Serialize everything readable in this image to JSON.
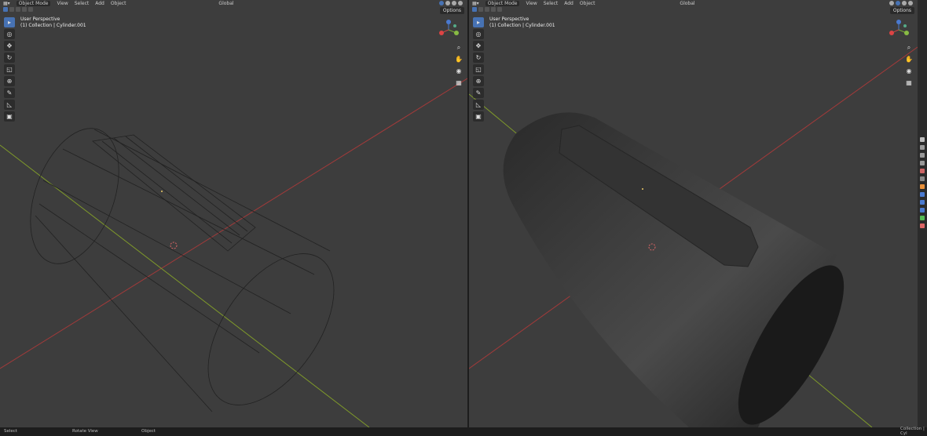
{
  "header": {
    "mode": "Object Mode",
    "menus": [
      "View",
      "Select",
      "Add",
      "Object"
    ],
    "orientation": "Global",
    "options": "Options"
  },
  "viewport_left": {
    "view_name": "User Perspective",
    "collection": "(1) Collection | Cylinder.001",
    "shading": "wireframe"
  },
  "viewport_right": {
    "view_name": "User Perspective",
    "collection": "(1) Collection | Cylinder.001",
    "shading": "solid"
  },
  "toolbar": [
    "select-box",
    "cursor",
    "move",
    "rotate",
    "scale",
    "transform",
    "annotate",
    "measure",
    "add-cube"
  ],
  "status_bar": {
    "select": "Select",
    "rotate_view": "Rotate View",
    "object": "Object",
    "right": "Collection | Cyl"
  },
  "colors": {
    "accent": "#4772b3",
    "x_axis": "#a33a3a",
    "y_axis": "#7f9a2a",
    "viewport_bg": "#3d3d3d"
  }
}
